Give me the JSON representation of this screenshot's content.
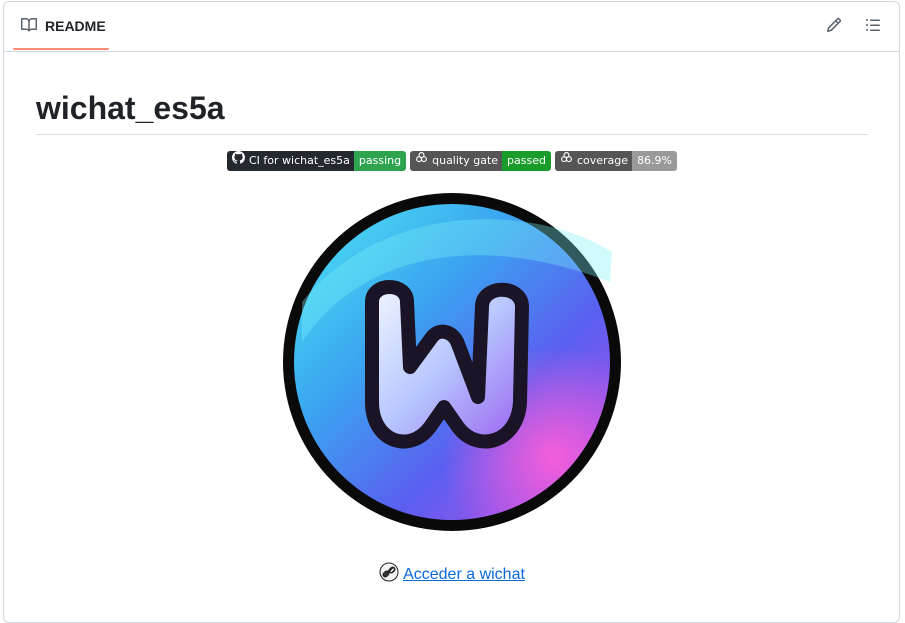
{
  "header": {
    "tab_label": "README"
  },
  "readme": {
    "title": "wichat_es5a",
    "badges": [
      {
        "label": "CI for wichat_es5a",
        "value": "passing",
        "value_color": "#2ea44f",
        "icon": "github-icon"
      },
      {
        "label": "quality gate",
        "value": "passed",
        "value_color": "#1a9c2a",
        "icon": "sonarcloud-icon"
      },
      {
        "label": "coverage",
        "value": "86.9%",
        "value_color": "#9a9a9a",
        "icon": "sonarcloud-icon"
      }
    ],
    "logo_icon": "wichat-logo",
    "link": {
      "text": "Acceder a wichat",
      "icon": "link-icon"
    }
  },
  "colors": {
    "accent": "#fd8c73",
    "link": "#0969da"
  }
}
